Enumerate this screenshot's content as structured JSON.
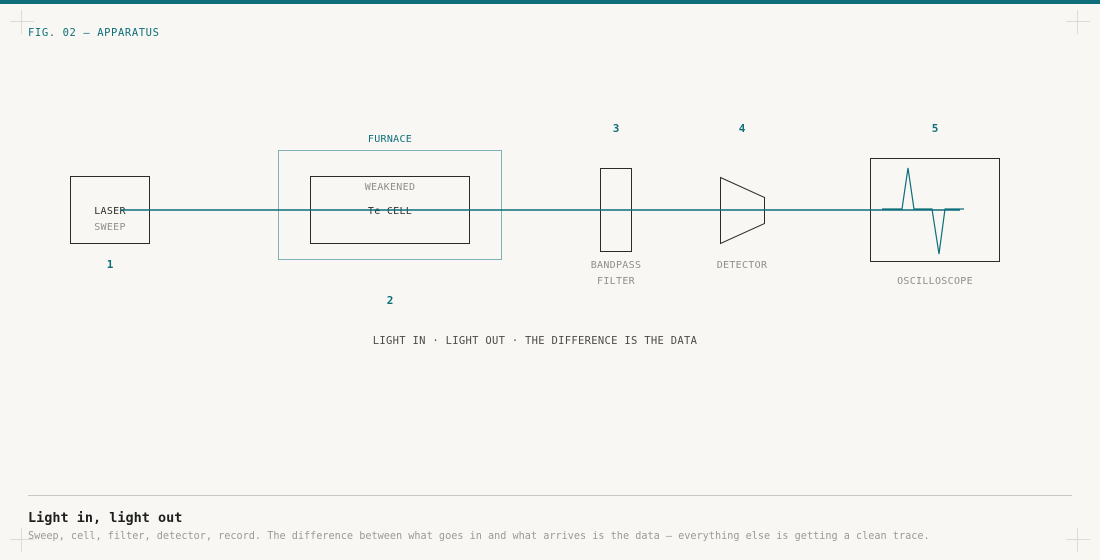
{
  "figure": {
    "label": "FIG. 02 — APPARATUS"
  },
  "diagram": {
    "components": {
      "laser": {
        "line1": "LASER",
        "line2": "SWEEP",
        "number": "1"
      },
      "furnace": {
        "label": "FURNACE",
        "number": "2"
      },
      "cell": {
        "line1": "WEAKENED",
        "line2": "Te CELL"
      },
      "filter": {
        "line1": "BANDPASS",
        "line2": "FILTER",
        "number": "3"
      },
      "detector": {
        "label": "DETECTOR",
        "number": "4"
      },
      "oscilloscope": {
        "label": "OSCILLOSCOPE",
        "number": "5"
      }
    },
    "tagline": "LIGHT IN · LIGHT OUT · THE DIFFERENCE IS THE DATA",
    "colors": {
      "accent": "#0e6f7a",
      "ink": "#2c2c2c",
      "muted": "#8e8e8a",
      "frame": "#7fb2b8"
    }
  },
  "caption": {
    "title": "Light in, light out",
    "body": "Sweep, cell, filter, detector, record. The difference between what goes in and what arrives is the data — everything else is getting a clean trace."
  }
}
